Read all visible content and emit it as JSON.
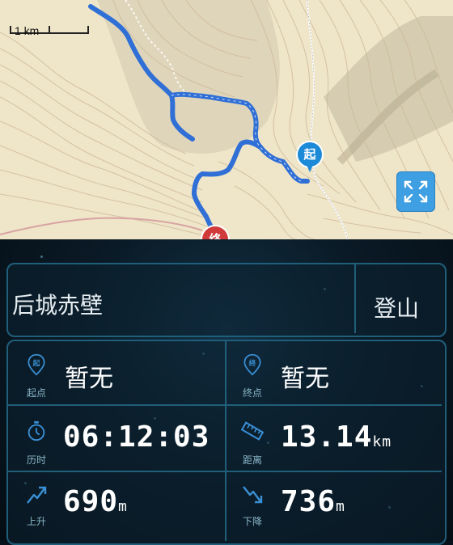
{
  "map": {
    "scale_label": "1 km",
    "start_marker": "起",
    "end_marker": "终",
    "expand_icon": "expand-arrows-icon"
  },
  "route": {
    "name": "后城赤壁",
    "type": "登山"
  },
  "stats": {
    "start_label": "起点",
    "start_value": "暂无",
    "start_icon_char": "起",
    "end_label": "终点",
    "end_value": "暂无",
    "end_icon_char": "终",
    "duration_label": "历时",
    "duration_value": "06:12:03",
    "distance_label": "距离",
    "distance_value": "13.14",
    "distance_unit": "km",
    "ascent_label": "上升",
    "ascent_value": "690",
    "ascent_unit": "m",
    "descent_label": "下降",
    "descent_value": "736",
    "descent_unit": "m"
  },
  "colors": {
    "route": "#2f6fd6",
    "accent": "#3a8fd4",
    "panel_border": "#1f5f7a"
  }
}
